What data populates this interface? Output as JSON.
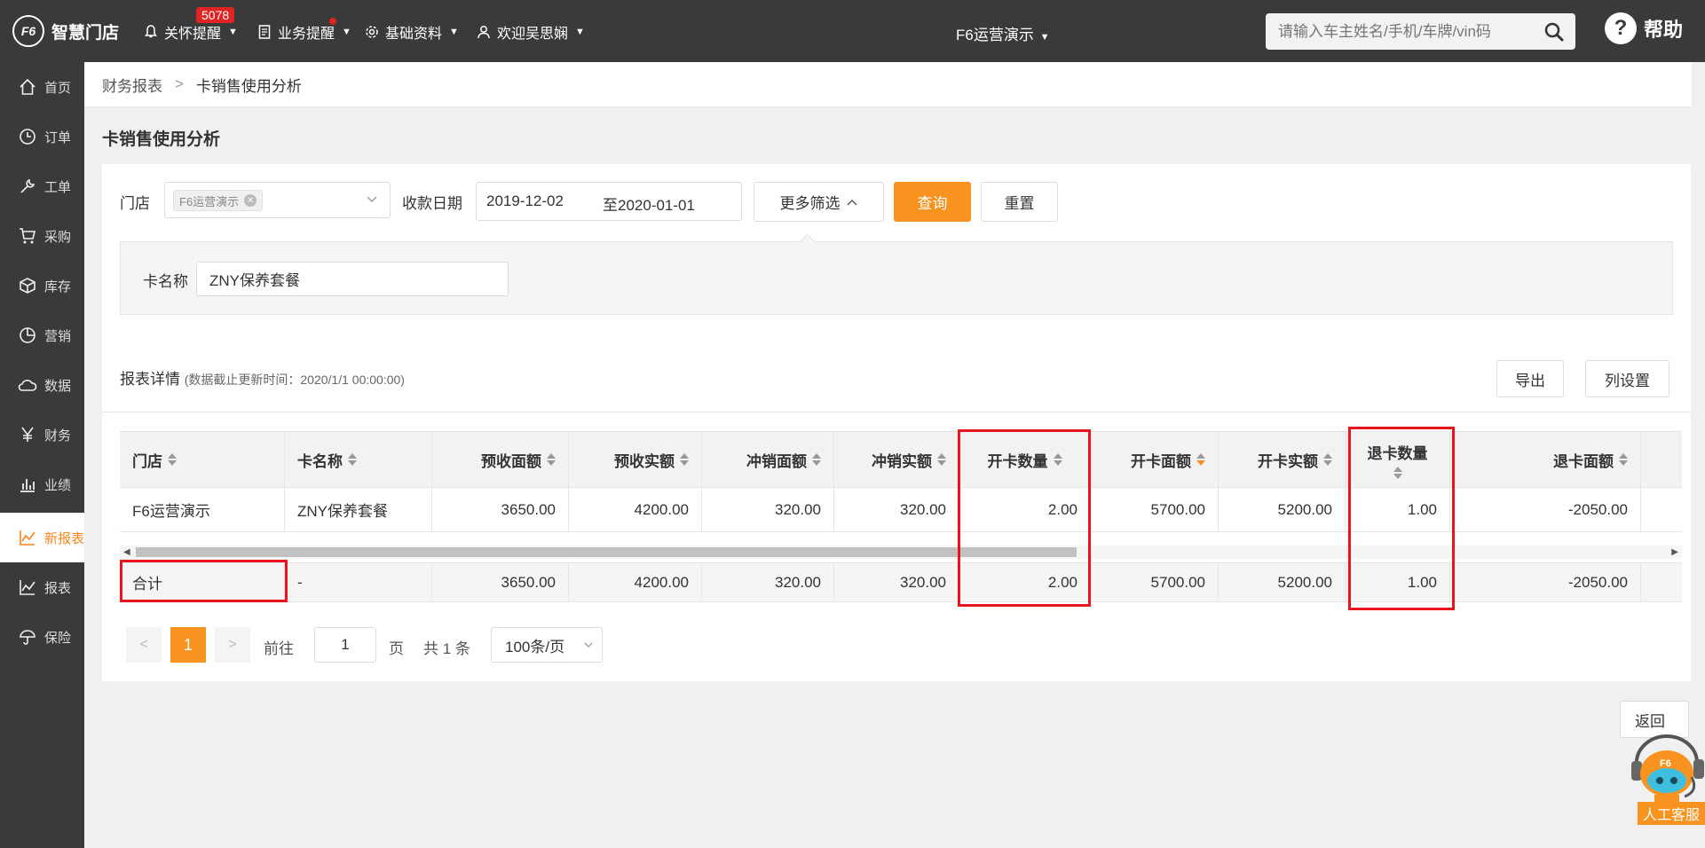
{
  "brand": {
    "logo_mark": "F6",
    "name": "智慧门店"
  },
  "topnav": {
    "care": {
      "label": "关怀提醒",
      "badge": "5078"
    },
    "business": {
      "label": "业务提醒"
    },
    "basic": {
      "label": "基础资料"
    },
    "user": {
      "label": "欢迎吴思娴"
    },
    "org": "F6运营演示",
    "search_placeholder": "请输入车主姓名/手机/车牌/vin码",
    "help": "帮助"
  },
  "sidebar": {
    "items": [
      {
        "label": "首页",
        "icon": "home-icon"
      },
      {
        "label": "订单",
        "icon": "clock-icon"
      },
      {
        "label": "工单",
        "icon": "wrench-icon"
      },
      {
        "label": "采购",
        "icon": "cart-icon"
      },
      {
        "label": "库存",
        "icon": "box-icon"
      },
      {
        "label": "营销",
        "icon": "pie-icon"
      },
      {
        "label": "数据",
        "icon": "cloud-icon"
      },
      {
        "label": "财务",
        "icon": "yen-icon"
      },
      {
        "label": "业绩",
        "icon": "bar-chart-icon"
      },
      {
        "label": "新报表",
        "icon": "line-chart-icon"
      },
      {
        "label": "报表",
        "icon": "line-chart-icon"
      },
      {
        "label": "保险",
        "icon": "umbrella-icon"
      }
    ],
    "active": "新报表"
  },
  "breadcrumb": {
    "parent": "财务报表",
    "separator": ">",
    "current": "卡销售使用分析"
  },
  "page_title": "卡销售使用分析",
  "filters": {
    "store_label": "门店",
    "store_tag": "F6运营演示",
    "date_label": "收款日期",
    "date_from": "2019-12-02",
    "date_to": "至2020-01-01",
    "more_filter": "更多筛选",
    "query": "查询",
    "reset": "重置",
    "card_name_label": "卡名称",
    "card_name_value": "ZNY保养套餐"
  },
  "report": {
    "title": "报表详情",
    "update_note": "(数据截止更新时间：2020/1/1 00:00:00)",
    "export": "导出",
    "column_settings": "列设置",
    "columns": [
      "门店",
      "卡名称",
      "预收面额",
      "预收实额",
      "冲销面额",
      "冲销实额",
      "开卡数量",
      "开卡面额",
      "开卡实额",
      "退卡数量",
      "退卡面额"
    ],
    "rows": [
      [
        "F6运营演示",
        "ZNY保养套餐",
        "3650.00",
        "4200.00",
        "320.00",
        "320.00",
        "2.00",
        "5700.00",
        "5200.00",
        "1.00",
        "-2050.00"
      ]
    ],
    "total": [
      "合计",
      "-",
      "3650.00",
      "4200.00",
      "320.00",
      "320.00",
      "2.00",
      "5700.00",
      "5200.00",
      "1.00",
      "-2050.00"
    ]
  },
  "pagination": {
    "prev": "<",
    "current": "1",
    "next": ">",
    "goto_label": "前往",
    "goto_value": "1",
    "page_unit": "页",
    "total": "共 1 条",
    "page_size": "100条/页"
  },
  "back": "返回",
  "customer_service": "人工客服",
  "colors": {
    "topbar": "#3a3a3a",
    "accent": "#f7931e",
    "highlight": "#e8141e"
  }
}
